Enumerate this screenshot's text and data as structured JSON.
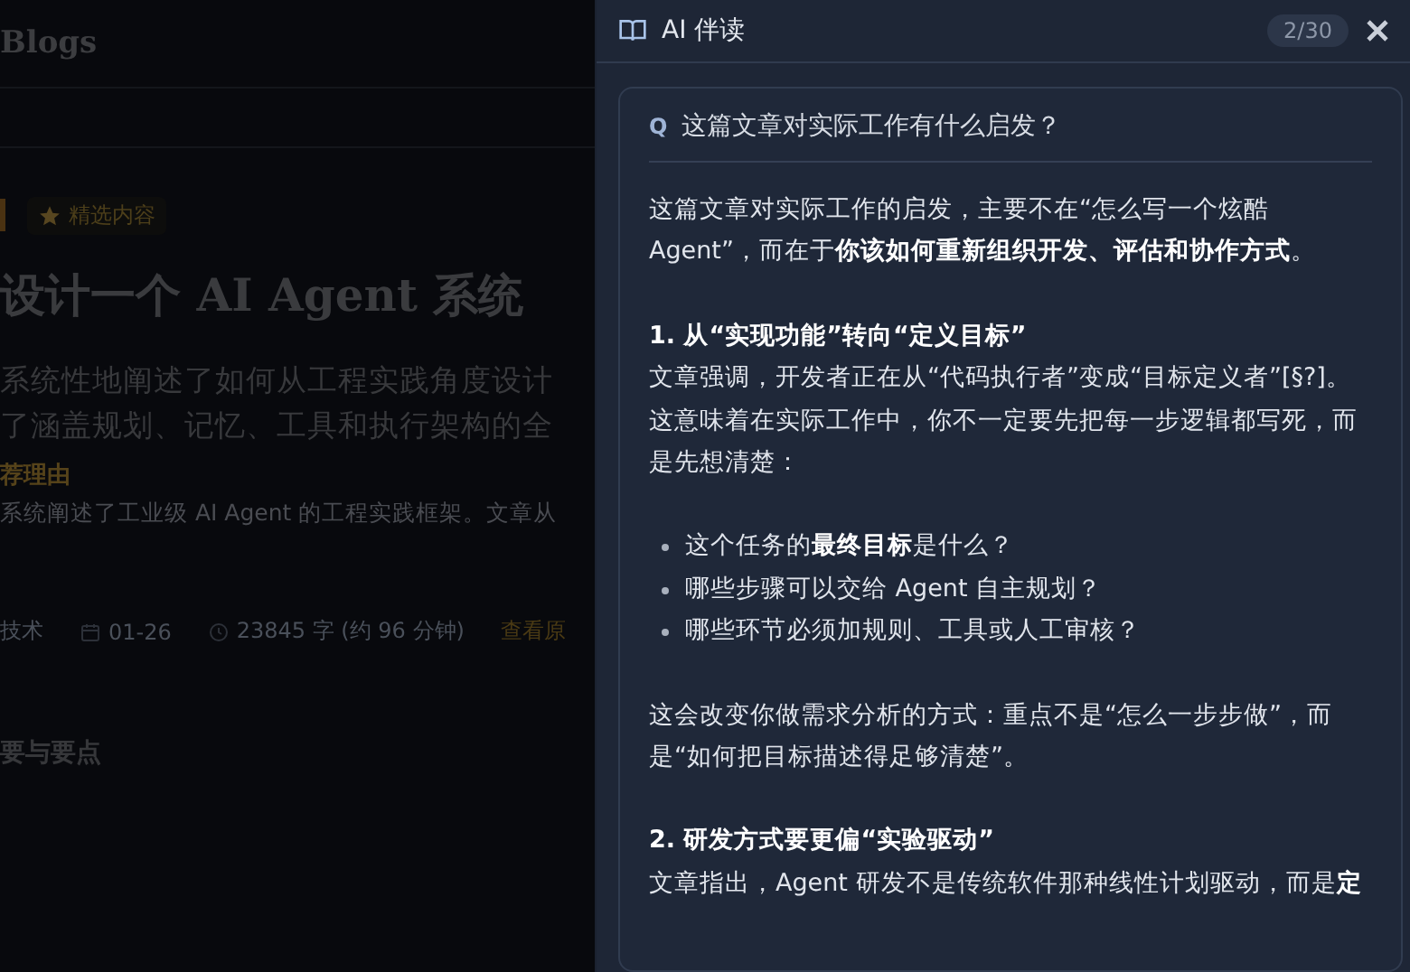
{
  "page": {
    "site_title": "Blogs",
    "tags": [
      {
        "kind": "edge"
      },
      {
        "kind": "featured",
        "label": "精选内容"
      }
    ],
    "title": "设计一个 AI Agent 系统",
    "summary_lines": [
      "系统性地阐述了如何从工程实践角度设计",
      "了涵盖规划、记忆、工具和执行架构的全"
    ],
    "reason_label": "荐理由",
    "reason_text": "系统阐述了工业级 AI Agent 的工程实践框架。文章从",
    "meta": {
      "category": "技术",
      "date": "01-26",
      "length": "23845 字 (约 96 分钟)",
      "link": "查看原"
    },
    "section_heading": "要与要点"
  },
  "panel": {
    "title": "AI 伴读",
    "counter": "2/30",
    "question": {
      "marker": "Q",
      "text": "这篇文章对实际工作有什么启发？"
    },
    "answer": [
      {
        "kind": "paragraph",
        "text": "这篇文章对实际工作的启发，主要不在“怎么写一个炫酷Agent”，而在于**你该如何重新组织开发、评估和协作方式**。"
      },
      {
        "kind": "heading",
        "text": "1. 从“实现功能”转向“定义目标”"
      },
      {
        "kind": "paragraph",
        "text": "文章强调，开发者正在从“代码执行者”变成“目标定义者”[§?]。这意味着在实际工作中，你不一定要先把每一步逻辑都写死，而是先想清楚："
      },
      {
        "kind": "bullets",
        "items": [
          "这个任务的**最终目标**是什么？",
          "哪些步骤可以交给 Agent 自主规划？",
          "哪些环节必须加规则、工具或人工审核？"
        ]
      },
      {
        "kind": "paragraph",
        "text": "这会改变你做需求分析的方式：重点不是“怎么一步步做”，而是“如何把目标描述得足够清楚”。"
      },
      {
        "kind": "heading",
        "text": "2. 研发方式要更偏“实验驱动”"
      },
      {
        "kind": "paragraph",
        "text": "文章指出，Agent 研发不是传统软件那种线性计划驱动，而是**定**"
      }
    ]
  }
}
